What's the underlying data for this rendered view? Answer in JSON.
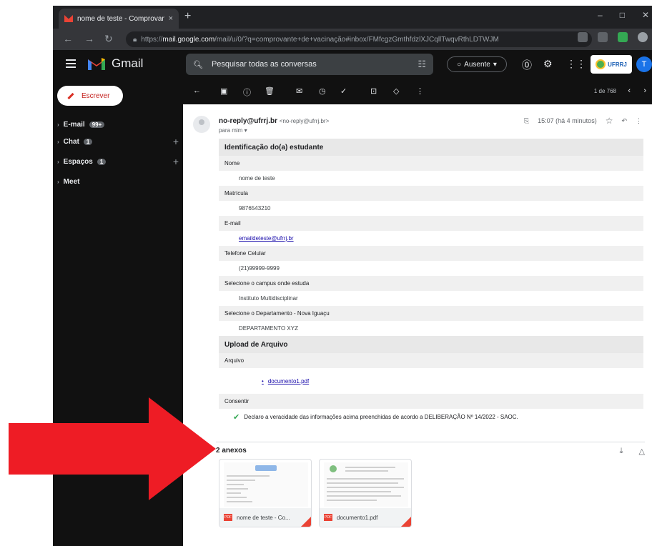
{
  "browser": {
    "tab_title": "nome de teste - Comprovante d",
    "tab_close": "×",
    "new_tab": "+",
    "url_host": "mail.google.com",
    "url_prefix": "https://",
    "url_path": "/mail/u/0/?q=comprovante+de+vacinação#inbox/FMfcgzGmthfdzlXJCqllTwqvRthLDTWJM",
    "window_controls": [
      "–",
      "□",
      "✕"
    ]
  },
  "gmail": {
    "app_name": "Gmail",
    "search_placeholder": "Pesquisar todas as conversas",
    "status": "Ausente",
    "org_logo_text": "UFRRJ",
    "avatar_letter": "T"
  },
  "sidebar": {
    "compose_label": "Escrever",
    "items": [
      {
        "label": "E-mail",
        "badge": "99+"
      },
      {
        "label": "Chat",
        "badge": "1"
      },
      {
        "label": "Espaços",
        "badge": "1"
      },
      {
        "label": "Meet"
      }
    ]
  },
  "toolbar": {
    "pager": "1 de 768"
  },
  "message": {
    "sender_name": "no-reply@ufrrj.br",
    "sender_addr": "<no-reply@ufrrj.br>",
    "to_line": "para mim ▾",
    "time": "15:07 (há 4 minutos)",
    "form": [
      {
        "kind": "section",
        "text": "Identificação do(a) estudante"
      },
      {
        "kind": "label",
        "text": "Nome"
      },
      {
        "kind": "value",
        "text": "nome de teste"
      },
      {
        "kind": "label",
        "text": "Matrícula"
      },
      {
        "kind": "value",
        "text": "9876543210"
      },
      {
        "kind": "label",
        "text": "E-mail"
      },
      {
        "kind": "link",
        "text": "emaildeteste@ufrrj.br"
      },
      {
        "kind": "label",
        "text": "Telefone Celular"
      },
      {
        "kind": "value",
        "text": "(21)99999-9999"
      },
      {
        "kind": "label",
        "text": "Selecione o campus onde estuda"
      },
      {
        "kind": "value",
        "text": "Instituto Multidisciplinar"
      },
      {
        "kind": "label",
        "text": "Selecione o Departamento - Nova Iguaçu"
      },
      {
        "kind": "value",
        "text": "DEPARTAMENTO XYZ"
      },
      {
        "kind": "section",
        "text": "Upload de Arquivo"
      },
      {
        "kind": "label",
        "text": "Arquivo"
      },
      {
        "kind": "bullet",
        "text": "documento1.pdf"
      },
      {
        "kind": "label",
        "text": "Consentir"
      },
      {
        "kind": "consent",
        "text": "Declaro a veracidade das informações acima preenchidas de acordo a DELIBERAÇÃO Nº 14/2022 - SAOC."
      }
    ],
    "attachments_title": "2 anexos",
    "attachments": [
      {
        "name": "nome de teste - Co...",
        "type": "PDF"
      },
      {
        "name": "documento1.pdf",
        "type": "PDF"
      }
    ]
  },
  "colors": {
    "arrow": "#ee1c25",
    "gmail_dark": "#111111",
    "check": "#34a853"
  }
}
